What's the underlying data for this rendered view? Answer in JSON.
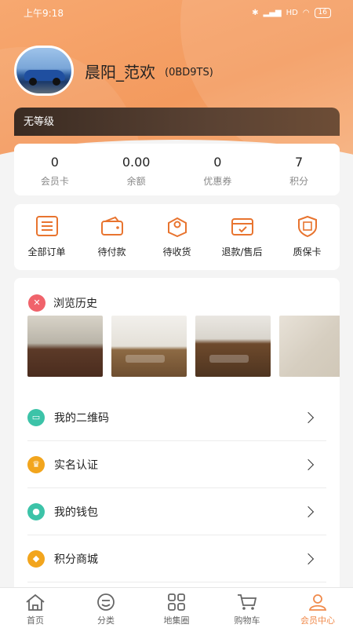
{
  "status_bar": {
    "time": "上午9:18",
    "signal": "HD",
    "battery": "16"
  },
  "profile": {
    "name": "晨阳_范欢",
    "code": "(0BD9TS)"
  },
  "level": "无等级",
  "stats": [
    {
      "value": "0",
      "label": "会员卡"
    },
    {
      "value": "0.00",
      "label": "余额"
    },
    {
      "value": "0",
      "label": "优惠券"
    },
    {
      "value": "7",
      "label": "积分"
    }
  ],
  "orders": [
    {
      "label": "全部订单",
      "icon": "list-icon"
    },
    {
      "label": "待付款",
      "icon": "wallet-icon"
    },
    {
      "label": "待收货",
      "icon": "package-icon"
    },
    {
      "label": "退款/售后",
      "icon": "refund-icon"
    },
    {
      "label": "质保卡",
      "icon": "warranty-icon"
    }
  ],
  "history": {
    "title": "浏览历史"
  },
  "menu": [
    {
      "label": "我的二维码",
      "icon": "qrcode-icon",
      "color": "#3cc3a8"
    },
    {
      "label": "实名认证",
      "icon": "certification-icon",
      "color": "#f2a51d"
    },
    {
      "label": "我的钱包",
      "icon": "wallet-icon",
      "color": "#3cc3a8"
    },
    {
      "label": "积分商城",
      "icon": "points-mall-icon",
      "color": "#f2a51d"
    }
  ],
  "tabs": [
    {
      "label": "首页",
      "icon": "home-icon"
    },
    {
      "label": "分类",
      "icon": "category-icon"
    },
    {
      "label": "地集圈",
      "icon": "grid-icon"
    },
    {
      "label": "购物车",
      "icon": "cart-icon"
    },
    {
      "label": "会员中心",
      "icon": "user-icon"
    }
  ],
  "colors": {
    "accent": "#f08a4b",
    "header": "#f39a5e",
    "level_bar": "#3a2b22"
  }
}
